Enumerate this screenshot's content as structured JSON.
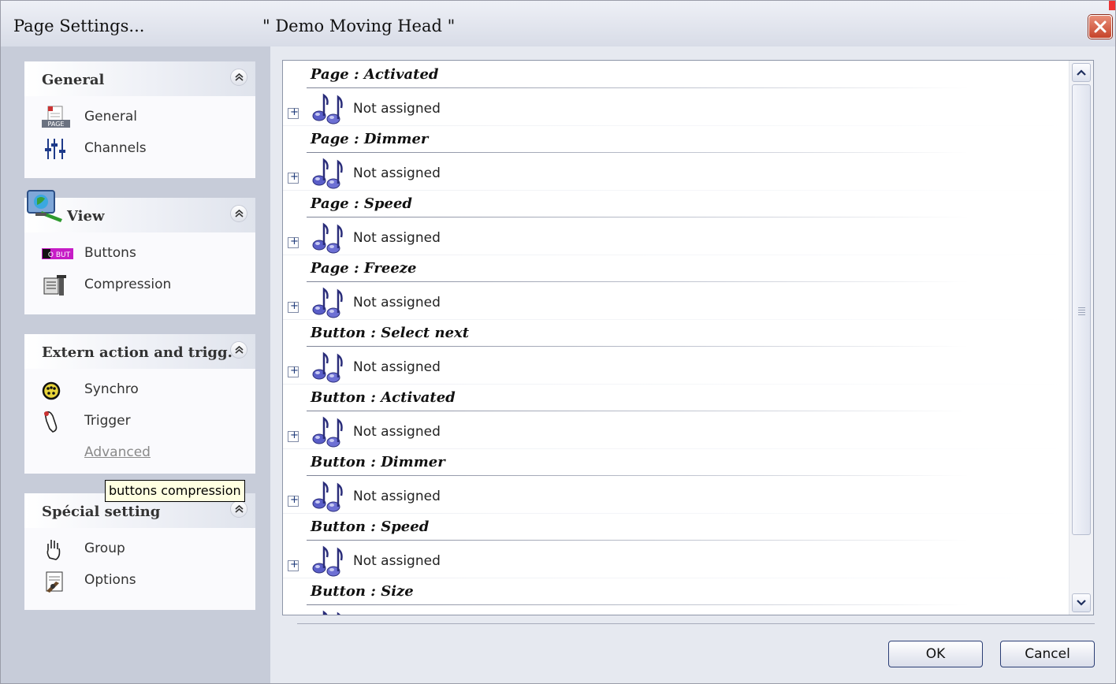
{
  "window": {
    "title": "Page  Settings...",
    "subtitle": "\" Demo Moving Head \""
  },
  "sidebar": {
    "groups": [
      {
        "title": "General",
        "items": [
          {
            "label": "General",
            "icon": "page-icon"
          },
          {
            "label": "Channels",
            "icon": "sliders-icon"
          }
        ]
      },
      {
        "title": "View",
        "items": [
          {
            "label": "Buttons",
            "icon": "buttons-icon"
          },
          {
            "label": "Compression",
            "icon": "compression-icon"
          }
        ]
      },
      {
        "title": "Extern action and trigg...",
        "items": [
          {
            "label": "Synchro",
            "icon": "dmx-connector-icon"
          },
          {
            "label": "Trigger",
            "icon": "trigger-hand-icon"
          },
          {
            "label": "Advanced",
            "icon": "",
            "disabled": true
          }
        ]
      },
      {
        "title": "Spécial setting",
        "items": [
          {
            "label": "Group",
            "icon": "hand-icon"
          },
          {
            "label": "Options",
            "icon": "options-icon"
          }
        ]
      }
    ],
    "buttons_icon_text": "O BUT",
    "page_icon_text": "PAGE"
  },
  "tooltip": "buttons compression",
  "list": {
    "entries": [
      {
        "title": "Page : Activated",
        "value": "Not assigned"
      },
      {
        "title": "Page : Dimmer",
        "value": "Not assigned"
      },
      {
        "title": "Page : Speed",
        "value": "Not assigned"
      },
      {
        "title": "Page : Freeze",
        "value": "Not assigned"
      },
      {
        "title": "Button : Select next",
        "value": "Not assigned"
      },
      {
        "title": "Button : Activated",
        "value": "Not assigned"
      },
      {
        "title": "Button : Dimmer",
        "value": "Not assigned"
      },
      {
        "title": "Button : Speed",
        "value": "Not assigned"
      },
      {
        "title": "Button : Size",
        "value": ""
      }
    ],
    "expand_symbol": "+"
  },
  "footer": {
    "ok_label": "OK",
    "cancel_label": "Cancel"
  },
  "colors": {
    "sidebar_bg": "#c7ccd9",
    "close_button": "#c6432a",
    "note_icon": "#5a5ec8",
    "tooltip_bg": "#ffffe1"
  }
}
